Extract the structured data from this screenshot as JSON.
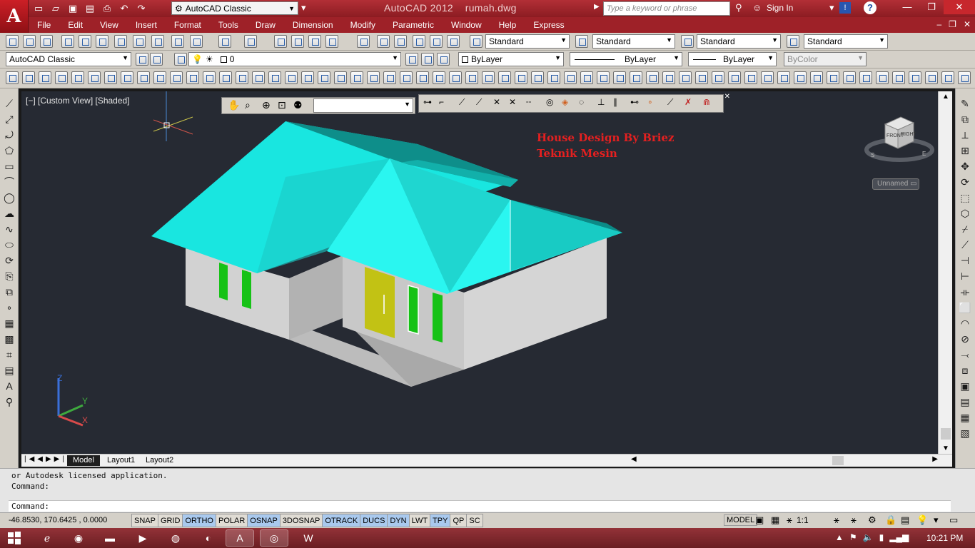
{
  "window": {
    "title": "AutoCAD 2012    rumah.dwg",
    "app_logo_letter": "A",
    "workspace": "AutoCAD Classic",
    "search_placeholder": "Type a keyword or phrase",
    "signin": "Sign In",
    "help": "?"
  },
  "menu": {
    "items": [
      "File",
      "Edit",
      "View",
      "Insert",
      "Format",
      "Tools",
      "Draw",
      "Dimension",
      "Modify",
      "Parametric",
      "Window",
      "Help",
      "Express"
    ]
  },
  "styles_toolbar": {
    "text_style": "Standard",
    "dim_style": "Standard",
    "table_style": "Standard",
    "mleader_style": "Standard"
  },
  "layers_toolbar": {
    "workspace": "AutoCAD Classic",
    "layer": "0",
    "color": "ByLayer",
    "linetype": "ByLayer",
    "lineweight": "ByLayer",
    "plotstyle": "ByColor"
  },
  "viewport": {
    "label": "[−] [Custom View] [Shaded]",
    "overlay_line1": "House Design By Briez",
    "overlay_line2": "Teknik Mesin",
    "viewcube_front": "FRONT",
    "viewcube_right": "RIGHT",
    "viewcube_s": "S",
    "viewcube_e": "E",
    "view_name": "Unnamed",
    "ucs_z": "Z",
    "ucs_y": "Y",
    "ucs_x": "X"
  },
  "layout_tabs": [
    "Model",
    "Layout1",
    "Layout2"
  ],
  "command": {
    "history_line": "or Autodesk licensed application.",
    "prompt1": "Command:",
    "prompt2": "Command:"
  },
  "status": {
    "coordinates": "-46.8530, 170.6425 , 0.0000",
    "toggles": [
      {
        "label": "SNAP",
        "on": false
      },
      {
        "label": "GRID",
        "on": false
      },
      {
        "label": "ORTHO",
        "on": true
      },
      {
        "label": "POLAR",
        "on": false
      },
      {
        "label": "OSNAP",
        "on": true
      },
      {
        "label": "3DOSNAP",
        "on": false
      },
      {
        "label": "OTRACK",
        "on": true
      },
      {
        "label": "DUCS",
        "on": true
      },
      {
        "label": "DYN",
        "on": true
      },
      {
        "label": "LWT",
        "on": false
      },
      {
        "label": "TPY",
        "on": true
      },
      {
        "label": "QP",
        "on": false
      },
      {
        "label": "SC",
        "on": false
      }
    ],
    "model": "MODEL",
    "scale": "1:1"
  },
  "taskbar": {
    "clock": "10:21 PM"
  },
  "colors": {
    "roof": "#19e6e0",
    "roof_light": "#2af6f0",
    "roof_shade": "#0e8e8a",
    "wall": "#c8c8c8",
    "window": "#16c216",
    "door": "#c2c214",
    "background": "#262a33",
    "overlay_text": "#e52020"
  }
}
